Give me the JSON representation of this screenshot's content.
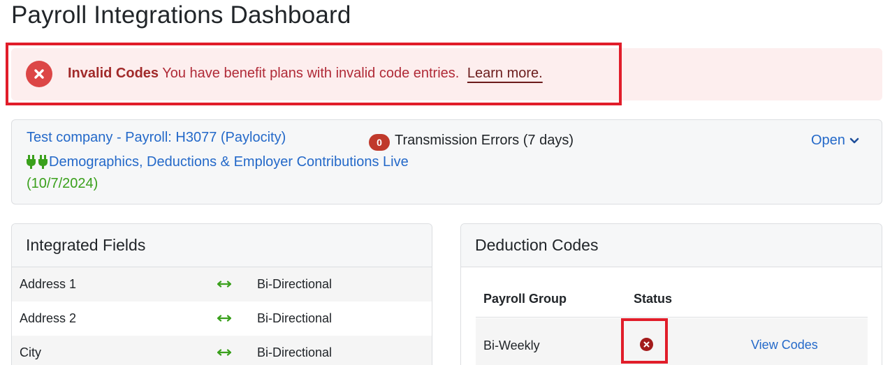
{
  "page": {
    "title": "Payroll Integrations Dashboard"
  },
  "alert": {
    "title": "Invalid Codes",
    "message": "You have benefit plans with invalid code entries.",
    "link": "Learn more.",
    "icon": "error-circle-icon",
    "color": "#dc4646"
  },
  "company": {
    "name": "Test company - Payroll: H3077 (Paylocity)",
    "status": "Demographics, Deductions & Employer Contributions Live",
    "date": "(10/7/2024)",
    "status_icon": "plug-icon",
    "errors": {
      "count": "0",
      "label": "Transmission Errors (7 days)"
    },
    "toggle": "Open"
  },
  "integrated_fields": {
    "title": "Integrated Fields",
    "rows": [
      {
        "name": "Address 1",
        "direction": "Bi-Directional"
      },
      {
        "name": "Address 2",
        "direction": "Bi-Directional"
      },
      {
        "name": "City",
        "direction": "Bi-Directional"
      }
    ]
  },
  "deduction_codes": {
    "title": "Deduction Codes",
    "columns": {
      "group": "Payroll Group",
      "status": "Status"
    },
    "rows": [
      {
        "group": "Bi-Weekly",
        "status_icon": "error-circle-icon",
        "link": "View Codes"
      }
    ]
  },
  "colors": {
    "link": "#2469c9",
    "success": "#3aa01c",
    "danger": "#c0392b",
    "highlight": "#e11d2a"
  }
}
